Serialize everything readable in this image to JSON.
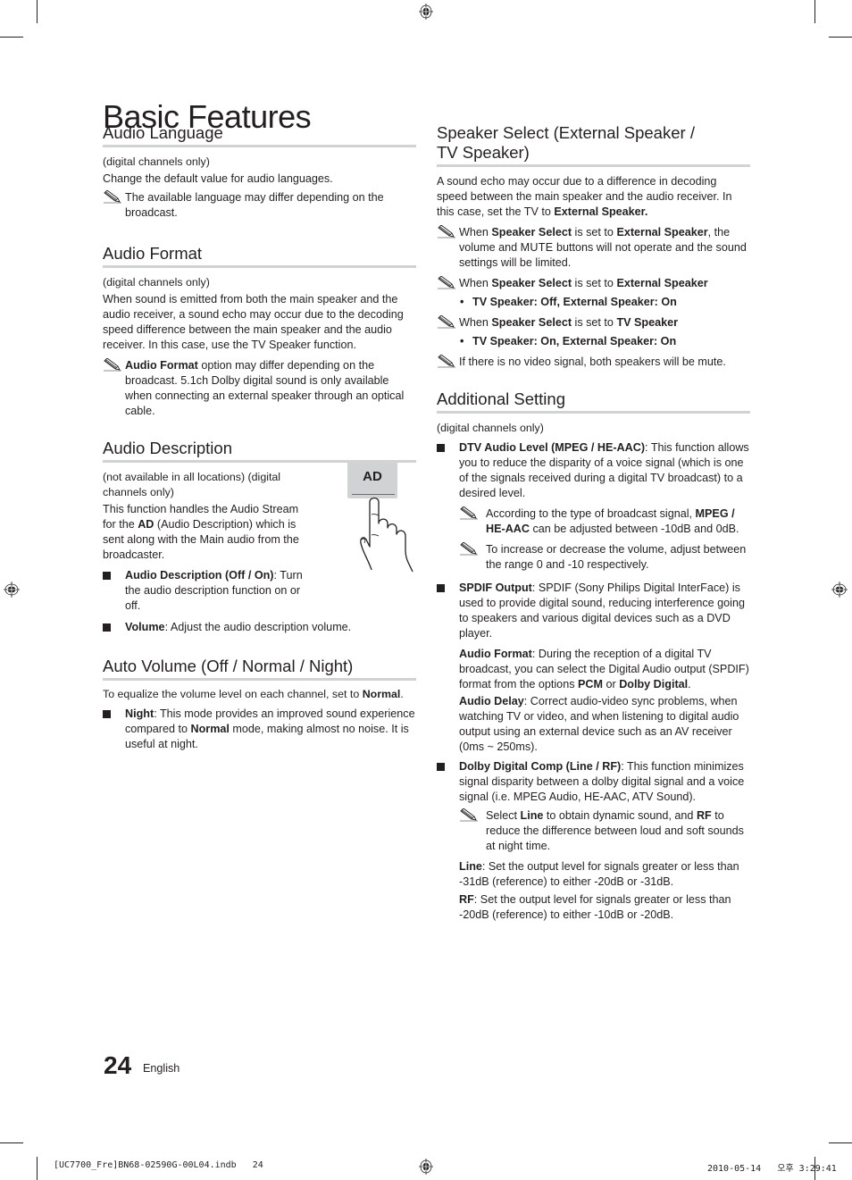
{
  "page": {
    "title": "Basic Features",
    "page_number": "24",
    "language": "English",
    "footer_file": "[UC7700_Fre]BN68-02590G-00L04.indb   24",
    "footer_timestamp": "2010-05-14   오후 3:29:41"
  },
  "audio_language": {
    "title": "Audio Language",
    "scope": "(digital channels only)",
    "body": "Change the default value for audio languages.",
    "note": "The available language may differ depending on the broadcast."
  },
  "audio_format": {
    "title": "Audio Format",
    "scope": "(digital channels only)",
    "body": "When sound is emitted from both the main speaker and the audio receiver, a sound echo may occur due to the decoding speed difference between the main speaker and the audio receiver. In this case, use the TV Speaker function.",
    "note_bold": "Audio Format",
    "note_rest": " option may differ depending on the broadcast. 5.1ch Dolby digital sound is only available when connecting an external speaker through an optical cable."
  },
  "audio_description": {
    "title": "Audio Description",
    "scope": "(not available in all locations) (digital channels only)",
    "body_1": "This function handles the Audio Stream for the ",
    "body_bold": "AD",
    "body_2": " (Audio Description) which is sent along with the Main audio from the broadcaster.",
    "button_label": "AD",
    "items": [
      {
        "label": "Audio Description (Off / On)",
        "text": ": Turn the audio description function on or off."
      },
      {
        "label": "Volume",
        "text": ": Adjust the audio description volume."
      }
    ]
  },
  "auto_volume": {
    "title": "Auto Volume (Off / Normal / Night)",
    "body_1": "To equalize the volume level on each channel, set to ",
    "body_bold": "Normal",
    "body_2": ".",
    "item_label": "Night",
    "item_text_1": ": This mode provides an improved sound experience compared to ",
    "item_bold": "Normal",
    "item_text_2": " mode, making almost no noise. It is useful at night."
  },
  "speaker_select": {
    "title": "Speaker Select (External Speaker / TV Speaker)",
    "body_1": "A sound echo may occur due to a difference in decoding speed between the main speaker and the audio receiver. In this case, set the TV to ",
    "body_bold": "External Speaker.",
    "note1": {
      "t1": "When ",
      "b1": "Speaker Select",
      "t2": " is set to ",
      "b2": "External Speaker",
      "t3": ", the volume and ",
      "b3": "MUTE",
      "t4": " buttons will not operate and the sound settings will be limited."
    },
    "note2": {
      "t1": "When ",
      "b1": "Speaker Select",
      "t2": " is set to ",
      "b2": "External Speaker",
      "item": "TV Speaker: Off, External Speaker: On"
    },
    "note3": {
      "t1": "When ",
      "b1": "Speaker Select",
      "t2": " is set to ",
      "b2": "TV Speaker",
      "item": "TV Speaker: On, External Speaker: On"
    },
    "note4": "If there is no video signal, both speakers will be mute."
  },
  "additional_setting": {
    "title": "Additional Setting",
    "scope": "(digital channels only)",
    "dtv": {
      "label": "DTV Audio Level (MPEG / HE-AAC)",
      "text": ": This function allows you to reduce the disparity of a voice signal (which is one of the signals received during a digital TV broadcast) to a desired level.",
      "note1_t1": "According to the type of broadcast signal, ",
      "note1_b1": "MPEG / HE-AAC",
      "note1_t2": " can be adjusted between -10dB and 0dB.",
      "note2": "To increase or decrease the volume, adjust between the range 0 and -10 respectively."
    },
    "spdif": {
      "label": "SPDIF Output",
      "text": ": SPDIF (Sony Philips Digital InterFace) is used to provide digital sound, reducing interference going to speakers and various digital devices such as a DVD player.",
      "format_label": "Audio Format",
      "format_t1": ": During the reception of a digital TV broadcast, you can select the Digital Audio output (SPDIF) format from the options ",
      "format_b1": "PCM",
      "format_t2": " or ",
      "format_b2": "Dolby Digital",
      "format_t3": ".",
      "delay_label": "Audio Delay",
      "delay_text": ": Correct audio-video sync problems, when watching TV or video, and when listening to digital audio output using an external device such as an AV receiver (0ms ~ 250ms)."
    },
    "dolby": {
      "label": "Dolby Digital Comp (Line / RF)",
      "text": ": This function minimizes signal disparity between a dolby digital signal and a voice signal (i.e. MPEG Audio, HE-AAC, ATV Sound).",
      "note_t1": "Select ",
      "note_b1": "Line",
      "note_t2": " to obtain dynamic sound, and ",
      "note_b2": "RF",
      "note_t3": " to reduce the difference between loud and soft sounds at night time.",
      "line_label": "Line",
      "line_text": ": Set the output level for signals greater or less than -31dB (reference) to either -20dB or -31dB.",
      "rf_label": "RF",
      "rf_text": ": Set the output level for signals greater or less than -20dB (reference) to either -10dB or -20dB."
    }
  }
}
